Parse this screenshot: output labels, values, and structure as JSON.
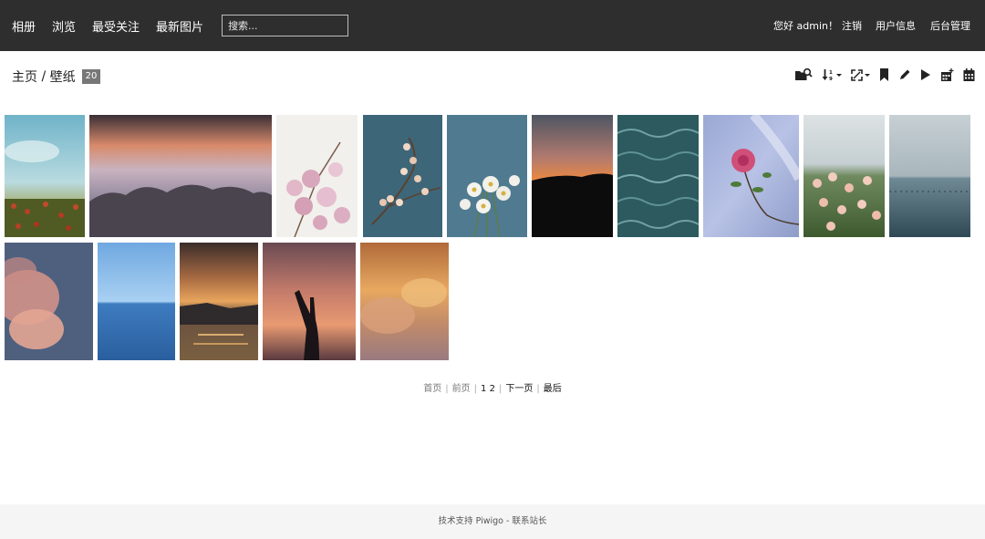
{
  "nav": {
    "links": [
      "相册",
      "浏览",
      "最受关注",
      "最新图片"
    ],
    "search_placeholder": "搜索...",
    "greeting": "您好 admin！",
    "logout": "注销",
    "user_info": "用户信息",
    "admin": "后台管理"
  },
  "title": {
    "home": "主页",
    "separator": " / ",
    "album": "壁纸",
    "count": "20"
  },
  "toolbar_icons": [
    "search-album-icon",
    "sort-icon",
    "photo-size-icon",
    "bookmark-icon",
    "edit-icon",
    "slideshow-icon",
    "calendar-posted-icon",
    "calendar-icon"
  ],
  "pagination": {
    "first": "首页",
    "prev": "前页",
    "pages": "1 2",
    "next": "下一页",
    "last": "最后",
    "separator": "|"
  },
  "footer": {
    "text": "技术支持 Piwigo - 联系站长"
  },
  "thumb_themes": [
    "field-sky",
    "sunset-clouds",
    "pink-blossom-light",
    "blossom-teal",
    "white-flowers-teal",
    "orange-sunset-hill",
    "sea-waves",
    "pink-rose-sky",
    "roses-bush",
    "calm-sea",
    "pink-clouds",
    "blue-sea",
    "sunset-sea",
    "hand-sunset",
    "golden-clouds"
  ]
}
